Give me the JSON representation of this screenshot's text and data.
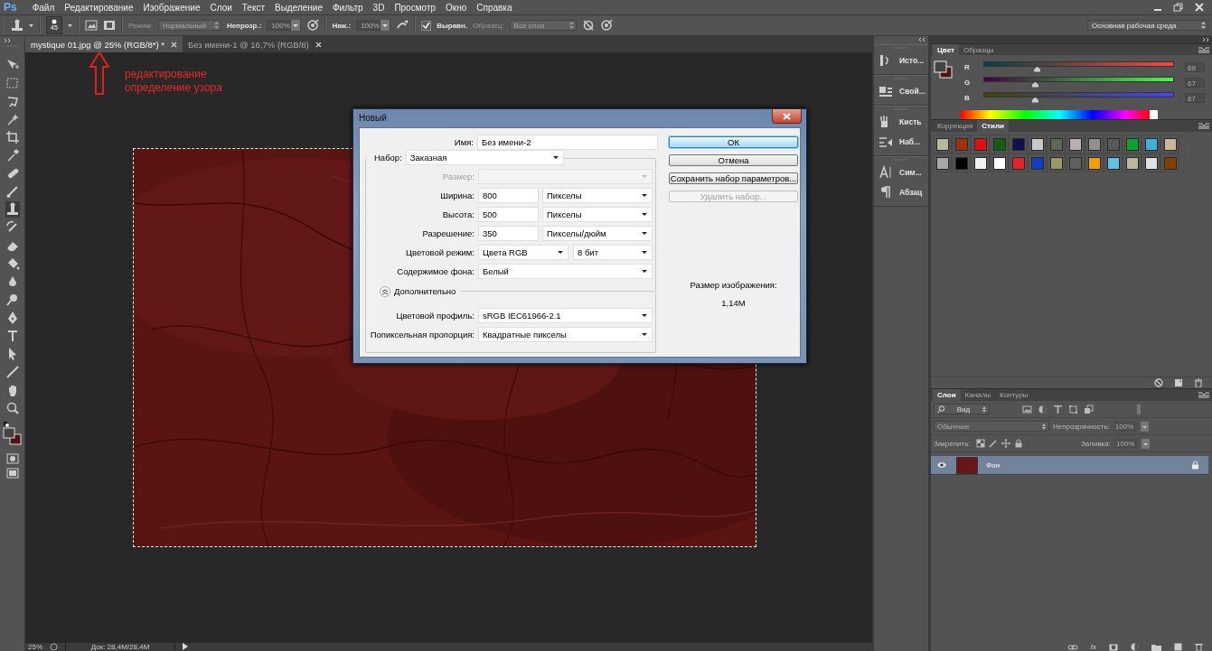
{
  "app": {
    "logo": "Ps"
  },
  "menu": [
    {
      "label": "Файл"
    },
    {
      "label": "Редактирование"
    },
    {
      "label": "Изображение"
    },
    {
      "label": "Слои"
    },
    {
      "label": "Текст"
    },
    {
      "label": "Выделение"
    },
    {
      "label": "Фильтр"
    },
    {
      "label": "3D"
    },
    {
      "label": "Просмотр"
    },
    {
      "label": "Окно"
    },
    {
      "label": "Справка"
    }
  ],
  "options_bar": {
    "brush_size": "45",
    "mode_label": "Режим:",
    "mode_value": "Нормальный",
    "opacity_label": "Непрозр.:",
    "opacity_value": "100%",
    "flow_label": "Наж.:",
    "flow_value": "100%",
    "aligned": {
      "label": "Выравн.",
      "checked": true
    },
    "sample_label": "Образец:",
    "sample_value": "Все слои",
    "workspace": "Основная рабочая среда"
  },
  "document_tabs": [
    {
      "label": "mystique 01.jpg @ 25% (RGB/8*) *",
      "selected": true
    },
    {
      "label": "Без имени-1 @ 16,7% (RGB/8)",
      "selected": false
    }
  ],
  "annotation": {
    "lines": [
      "редактирование",
      "определение узора"
    ]
  },
  "status_bar": {
    "zoom": "25%",
    "document_info": "Док: 28,4M/28,4M"
  },
  "dock": [
    {
      "items": [
        {
          "label": "Исто..."
        }
      ]
    },
    {
      "items": [
        {
          "label": "Свой..."
        }
      ]
    },
    {
      "items": [
        {
          "label": "Кисть"
        },
        {
          "label": "Наб..."
        }
      ]
    },
    {
      "items": [
        {
          "label": "Сим..."
        },
        {
          "label": "Абзац"
        }
      ]
    }
  ],
  "color_panel": {
    "tabs": [
      {
        "label": "Цвет",
        "selected": true
      },
      {
        "label": "Образцы",
        "selected": false
      }
    ],
    "channels": [
      {
        "name": "R",
        "level": 0.27,
        "reading": "69"
      },
      {
        "name": "G",
        "level": 0.26,
        "reading": "67"
      },
      {
        "name": "B",
        "level": 0.26,
        "reading": "67"
      }
    ]
  },
  "styles_panel": {
    "tabs": [
      {
        "label": "Коррекция",
        "selected": false
      },
      {
        "label": "Стили",
        "selected": true
      }
    ],
    "styles": [
      {
        "color": "#b8b8a0"
      },
      {
        "color": "#a03010"
      },
      {
        "color": "#e01010"
      },
      {
        "color": "#106010"
      },
      {
        "color": "#101050"
      },
      {
        "color": "#c8c8c8"
      },
      {
        "color": "#606858"
      },
      {
        "color": "#b8b0b0"
      },
      {
        "color": "#909090"
      },
      {
        "color": "#585858"
      },
      {
        "color": "#10a030"
      },
      {
        "color": "#40b0d8"
      },
      {
        "color": "#c8b898"
      },
      {
        "color": "#a8a8a8"
      },
      {
        "color": "#000000"
      },
      {
        "color": "#f0f0f0"
      },
      {
        "color": "#ffffff"
      },
      {
        "color": "#e82030"
      },
      {
        "color": "#1040c0"
      },
      {
        "color": "#989868"
      },
      {
        "color": "#606060"
      },
      {
        "color": "#f0a000"
      },
      {
        "color": "#60c0e0"
      },
      {
        "color": "#b8b8a0"
      },
      {
        "color": "#e0e0e0"
      },
      {
        "color": "#804000"
      }
    ]
  },
  "layers_panel": {
    "tabs": [
      {
        "label": "Слои",
        "selected": true
      },
      {
        "label": "Каналы",
        "selected": false
      },
      {
        "label": "Контуры",
        "selected": false
      }
    ],
    "filter": "Вид",
    "blend_mode": "Обычные",
    "opacity_label": "Непрозрачность:",
    "opacity_value": "100%",
    "lock_label": "Закрепить:",
    "fill_label": "Заливка:",
    "fill_value": "100%",
    "layers": [
      {
        "name": "Фон",
        "visible": true,
        "selected": true,
        "locked": true
      }
    ],
    "actions_label": "fx"
  },
  "dialog": {
    "title": "Новый",
    "name_field": {
      "label": "Имя:",
      "value": "Без имени-2"
    },
    "preset": {
      "label": "Набор:",
      "value": "Заказная"
    },
    "rows": [
      {
        "kind": "select",
        "label": "Размер:",
        "disabled": true
      },
      {
        "kind": "number_unit",
        "label": "Ширина:",
        "value": "800",
        "unit": "Пикселы",
        "disabled": false
      },
      {
        "kind": "number_unit",
        "label": "Высота:",
        "value": "500",
        "unit": "Пикселы",
        "disabled": false
      },
      {
        "kind": "number_unit",
        "label": "Разрешение:",
        "value": "350",
        "unit": "Пикселы/дюйм",
        "disabled": false
      },
      {
        "kind": "select_pair",
        "label": "Цветовой режим:",
        "value": "Цвета RGB",
        "unit": "8 бит",
        "disabled": false
      },
      {
        "kind": "select",
        "label": "Содержимое фона:",
        "value": "Белый",
        "disabled": false
      }
    ],
    "advanced": {
      "label": "Дополнительно",
      "expanded": true,
      "rows": [
        {
          "kind": "select",
          "label": "Цветовой профиль:",
          "value": "sRGB IEC61966-2.1",
          "disabled": false
        },
        {
          "kind": "select",
          "label": "Попиксельная пропорция:",
          "value": "Квадратные пикселы",
          "disabled": false
        }
      ]
    },
    "buttons": [
      {
        "label": "ОК",
        "default": true,
        "disabled": false
      },
      {
        "label": "Отмена",
        "default": false,
        "disabled": false
      },
      {
        "label": "Сохранить набор параметров...",
        "default": false,
        "disabled": false
      },
      {
        "label": "Удалить набор...",
        "default": false,
        "disabled": true
      }
    ],
    "image_size": {
      "label": "Размер изображения:",
      "value": "1,14M"
    }
  }
}
